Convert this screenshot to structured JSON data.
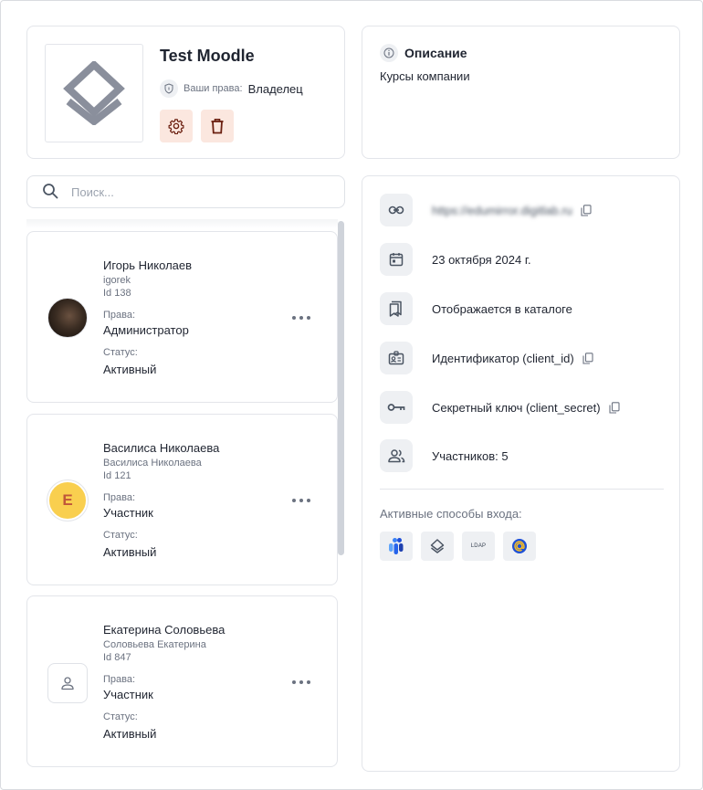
{
  "app": {
    "title": "Test Moodle",
    "rights_label": "Ваши права:",
    "rights_value": "Владелец"
  },
  "description": {
    "title": "Описание",
    "text": "Курсы компании"
  },
  "search": {
    "placeholder": "Поиск..."
  },
  "users": [
    {
      "name": "Игорь Николаев",
      "login": "igorek",
      "id": "Id 138",
      "rights_label": "Права:",
      "rights": "Администратор",
      "status_label": "Статус:",
      "status": "Активный",
      "avatar_type": "photo"
    },
    {
      "name": "Василиса Николаева",
      "login": "Василиса Николаева",
      "id": "Id 121",
      "rights_label": "Права:",
      "rights": "Участник",
      "status_label": "Статус:",
      "status": "Активный",
      "avatar_type": "letter",
      "avatar_letter": "E",
      "avatar_color": "#f9cf4f"
    },
    {
      "name": "Екатерина Соловьева",
      "login": "Соловьева Екатерина",
      "id": "Id 847",
      "rights_label": "Права:",
      "rights": "Участник",
      "status_label": "Статус:",
      "status": "Активный",
      "avatar_type": "placeholder"
    }
  ],
  "details": {
    "link": "https://edumirror.digitlab.ru",
    "date": "23 октября 2024 г.",
    "catalog": "Отображается в каталоге",
    "client_id": "Идентификатор (client_id)",
    "client_secret": "Секретный ключ (client_secret)",
    "participants": "Участников: 5",
    "login_methods_title": "Активные способы входа:",
    "login_methods": [
      {
        "icon": "logo-icon"
      },
      {
        "icon": "layers-icon"
      },
      {
        "icon": "ldap-icon",
        "label": "LDAP"
      },
      {
        "icon": "email-at-icon"
      }
    ]
  },
  "colors": {
    "accent_bg": "#fbe7df",
    "accent_icon": "#6b1f10",
    "icon_bg": "#eef0f3"
  }
}
